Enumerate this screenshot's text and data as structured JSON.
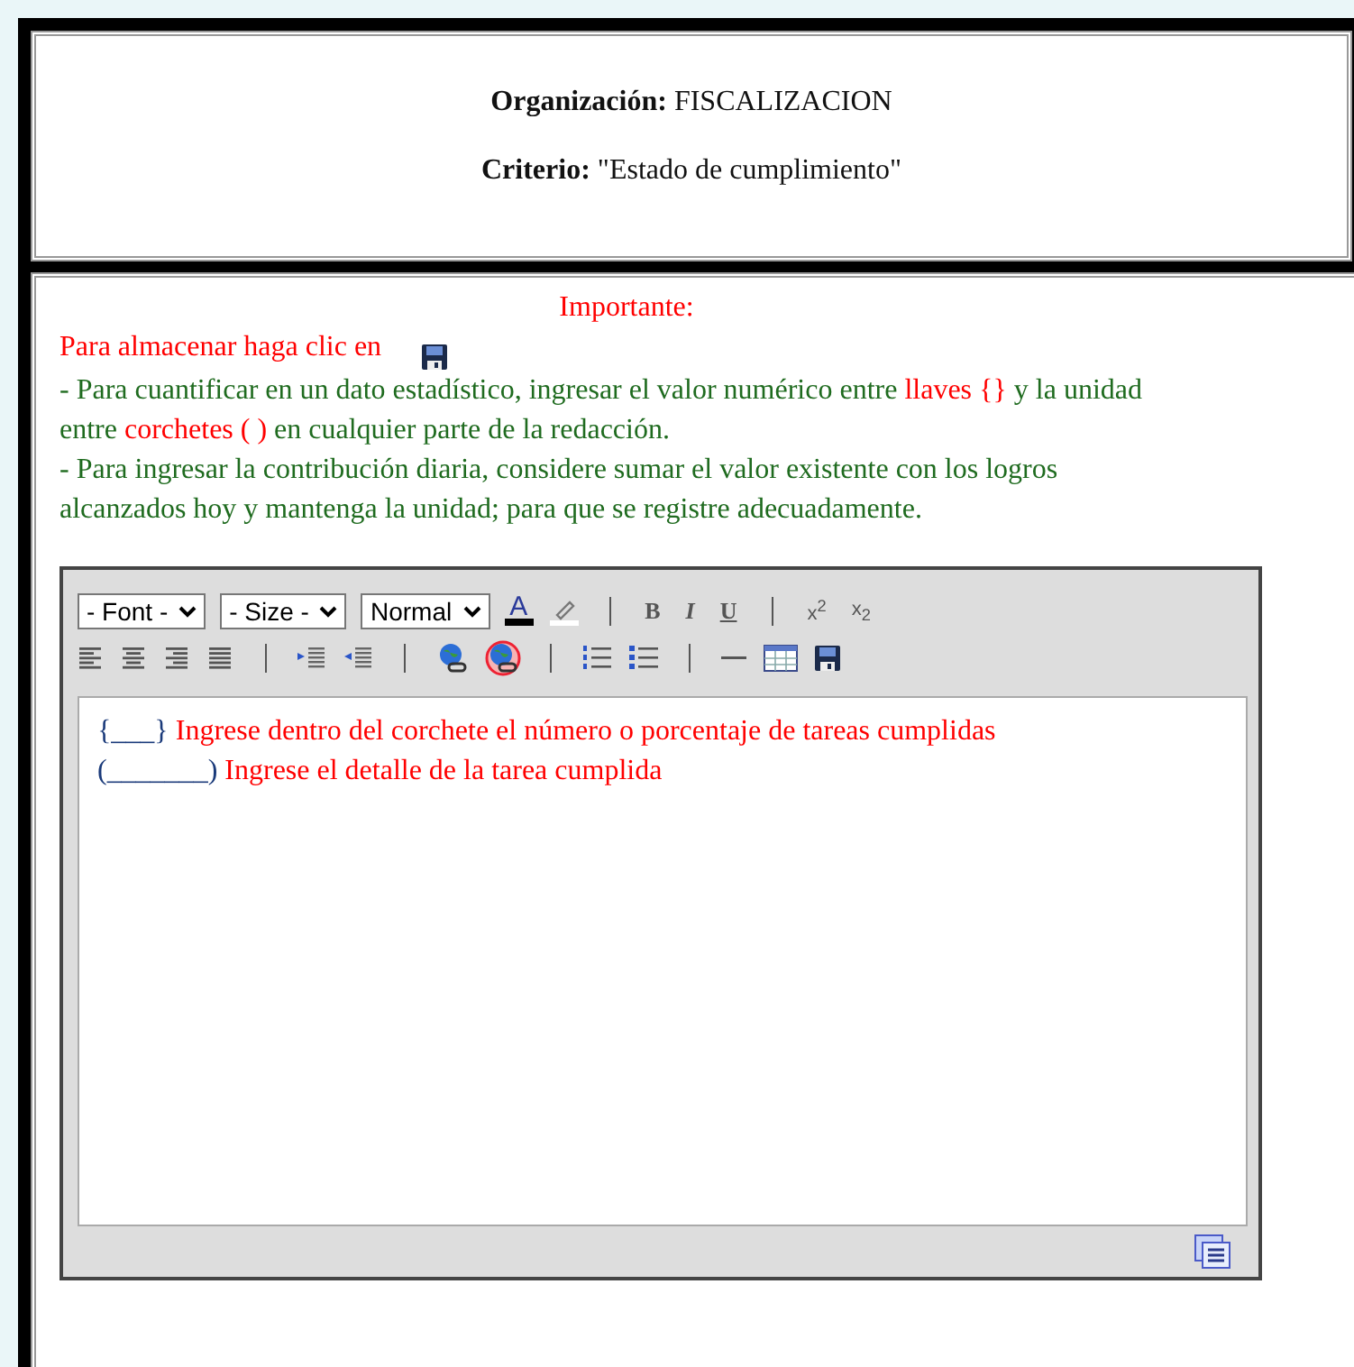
{
  "header": {
    "organization_label": "Organización:",
    "organization": "FISCALIZACION",
    "criterion_label": "Criterio:",
    "criterion": "\"Estado de cumplimiento\""
  },
  "notice": {
    "title": "Importante:",
    "save_hint": "Para almacenar haga clic en",
    "paragraphs": [
      [
        {
          "kind": "plain",
          "text": "- Para cuantificar en un dato estadístico, ingresar el valor numérico entre "
        },
        {
          "kind": "highlight",
          "text": "llaves {}"
        },
        {
          "kind": "plain",
          "text": " y la unidad entre "
        },
        {
          "kind": "highlight",
          "text": "corchetes ( )"
        },
        {
          "kind": "plain",
          "text": " en cualquier parte de la redacción."
        }
      ],
      [
        {
          "kind": "plain",
          "text": "- Para ingresar la contribución diaria, considere sumar el valor existente con los logros alcanzados hoy y mantenga la unidad; para que se registre adecuadamente."
        }
      ]
    ]
  },
  "toolbar": [
    [
      {
        "kind": "select",
        "value": "- Font -"
      },
      {
        "kind": "select",
        "value": "- Size -"
      },
      {
        "kind": "select",
        "value": "Normal"
      },
      {
        "kind": "font-color",
        "label": "A"
      },
      {
        "kind": "highlight"
      },
      {
        "kind": "sep"
      },
      {
        "kind": "bold",
        "label": "B"
      },
      {
        "kind": "italic",
        "label": "I"
      },
      {
        "kind": "underline",
        "label": "U"
      },
      {
        "kind": "sep"
      },
      {
        "kind": "script",
        "label": "x$^{2}$"
      },
      {
        "kind": "script",
        "label": "x$_{2}$"
      }
    ],
    [
      {
        "kind": "align-left"
      },
      {
        "kind": "align-center"
      },
      {
        "kind": "align-right"
      },
      {
        "kind": "align-justify"
      },
      {
        "kind": "sep"
      },
      {
        "kind": "indent"
      },
      {
        "kind": "outdent"
      },
      {
        "kind": "sep"
      },
      {
        "kind": "link"
      },
      {
        "kind": "unlink"
      },
      {
        "kind": "sep"
      },
      {
        "kind": "ordered-list"
      },
      {
        "kind": "bullet-list"
      },
      {
        "kind": "sep"
      },
      {
        "kind": "rule"
      },
      {
        "kind": "table"
      },
      {
        "kind": "save"
      }
    ]
  ],
  "editor_lines": [
    {
      "marker": "{___}",
      "text": "Ingrese dentro del corchete el número o porcentaje de tareas cumplidas"
    },
    {
      "marker": "(_______)",
      "text": "Ingrese el detalle de la tarea cumplida"
    }
  ]
}
